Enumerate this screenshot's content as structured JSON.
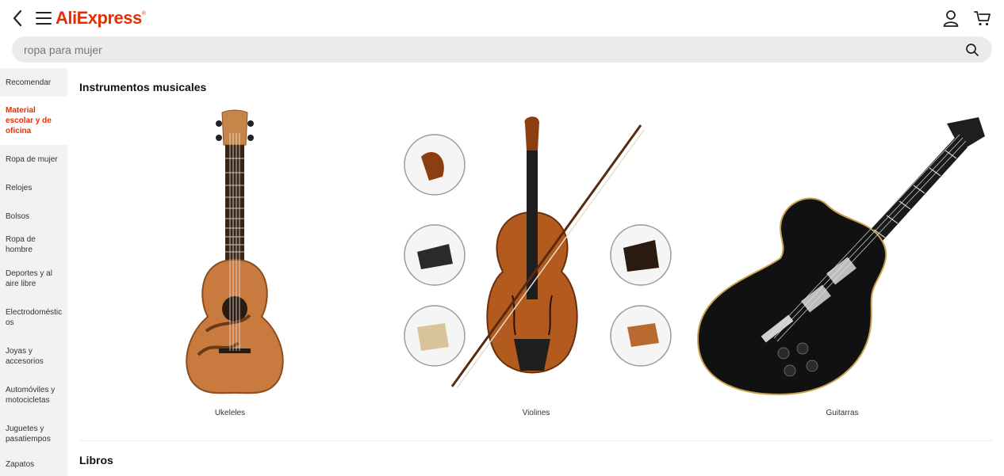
{
  "header": {
    "logo_text": "AliExpress",
    "logo_mark": "®",
    "back_icon": "chevron-left-icon",
    "menu_icon": "hamburger-icon",
    "user_icon": "user-icon",
    "cart_icon": "cart-icon",
    "brand_color": "#e62e04"
  },
  "search": {
    "placeholder": "ropa para mujer",
    "icon": "search-icon"
  },
  "sidebar": {
    "items": [
      {
        "label": "Recomendar",
        "active": false
      },
      {
        "label": "Material escolar y de oficina",
        "active": true
      },
      {
        "label": "Ropa de mujer",
        "active": false
      },
      {
        "label": "Relojes",
        "active": false
      },
      {
        "label": "Bolsos",
        "active": false
      },
      {
        "label": "Ropa de hombre",
        "active": false
      },
      {
        "label": "Deportes y al aire libre",
        "active": false
      },
      {
        "label": "Electrodomésticos",
        "active": false
      },
      {
        "label": "Joyas y accesorios",
        "active": false
      },
      {
        "label": "Automóviles y motocicletas",
        "active": false
      },
      {
        "label": "Juguetes y pasatiempos",
        "active": false
      },
      {
        "label": "Zapatos",
        "active": false
      }
    ]
  },
  "main": {
    "section1_title": "Instrumentos musicales",
    "products": [
      {
        "label": "Ukeleles",
        "image": "ukulele-image"
      },
      {
        "label": "Violines",
        "image": "violin-image"
      },
      {
        "label": "Guitarras",
        "image": "guitar-image"
      }
    ],
    "section2_title": "Libros"
  }
}
